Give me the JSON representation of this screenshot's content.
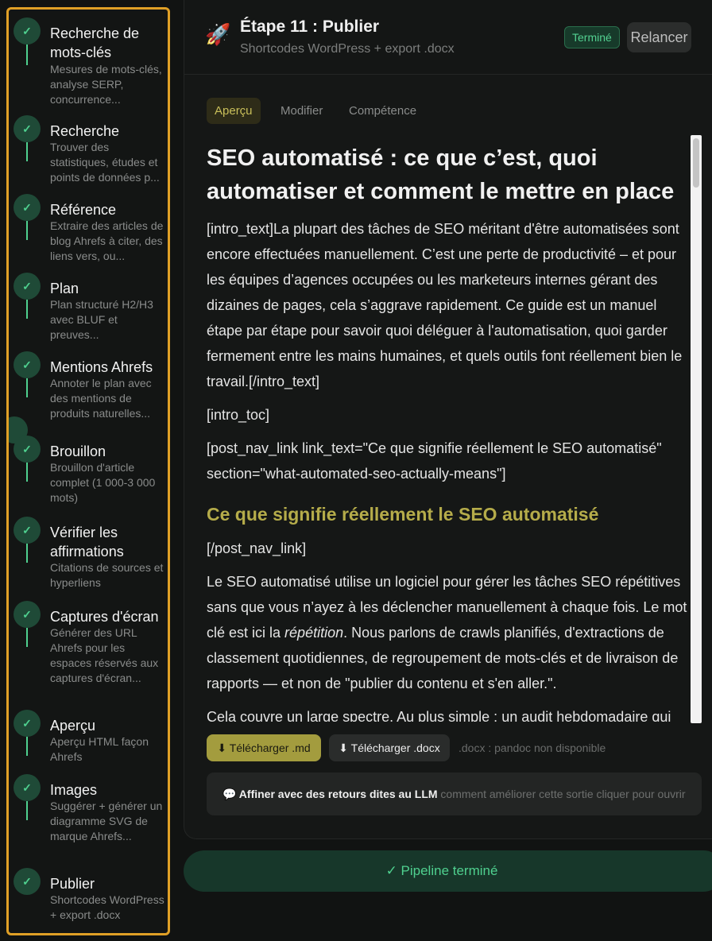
{
  "sidebar": {
    "steps": [
      {
        "title": "Recherche de mots-clés",
        "desc": "Mesures de mots-clés, analyse SERP, concurrence..."
      },
      {
        "title": "Recherche",
        "desc": "Trouver des statistiques, études et points de données p..."
      },
      {
        "title": "Référence",
        "desc": "Extraire des articles de blog Ahrefs à citer, des liens vers, ou..."
      },
      {
        "title": "Plan",
        "desc": "Plan structuré H2/H3 avec BLUF et preuves..."
      },
      {
        "title": "Mentions Ahrefs",
        "desc": "Annoter le plan avec des mentions de produits naturelles..."
      },
      {
        "title": "Brouillon",
        "desc": "Brouillon d'article complet (1 000-3 000 mots)"
      },
      {
        "title": "Vérifier les affirmations",
        "desc": "Citations de sources et hyperliens"
      },
      {
        "title": "Captures d'écran",
        "desc": "Générer des URL Ahrefs pour les espaces réservés aux captures d'écran..."
      },
      {
        "title": "Aperçu",
        "desc": "Aperçu HTML façon Ahrefs"
      },
      {
        "title": "Images",
        "desc": "Suggérer + générer un diagramme SVG de marque Ahrefs..."
      },
      {
        "title": "Publier",
        "desc": "Shortcodes WordPress + export .docx"
      }
    ],
    "check_glyph": "✓"
  },
  "header": {
    "icon": "🚀",
    "title": "Étape 11 : Publier",
    "subtitle": "Shortcodes WordPress + export .docx",
    "status_badge": "Terminé",
    "relaunch_label": "Relancer"
  },
  "tabs": [
    "Aperçu",
    "Modifier",
    "Compétence"
  ],
  "article": {
    "h1": "SEO automatisé : ce que c’est, quoi automatiser et comment le mettre en place",
    "intro": "[intro_text]La plupart des tâches de SEO méritant d'être automatisées sont encore effectuées manuellement. C’est une perte de productivité – et pour les équipes d’agences occupées ou les marketeurs internes gérant des dizaines de pages, cela s’aggrave rapidement. Ce guide est un manuel étape par étape pour savoir quoi déléguer à l'automatisation, quoi garder fermement entre les mains humaines, et quels outils font réellement bien le travail.[/intro_text]",
    "toc": "[intro_toc]",
    "nav_link": "[post_nav_link link_text=\"Ce que signifie réellement le SEO automatisé\" section=\"what-automated-seo-actually-means\"]",
    "h2": "Ce que signifie réellement le SEO automatisé",
    "nav_close": "[/post_nav_link]",
    "p1_before": "Le SEO automatisé utilise un logiciel pour gérer les tâches SEO répétitives sans que vous n’ayez à les déclencher manuellement à chaque fois. Le mot clé est ici la ",
    "p1_em": "répétition",
    "p1_after": ". Nous parlons de crawls planifiés, d'extractions de classement quotidiennes, de regroupement de mots-clés et de livraison de rapports — et non de \"publier du contenu et s'en aller.\".",
    "p2": "Cela couvre un large spectre. Au plus simple : un audit hebdomadaire qui"
  },
  "actions": {
    "download_md": "⬇ Télécharger .md",
    "download_docx": "⬇ Télécharger .docx",
    "docx_note": ".docx : pandoc non disponible"
  },
  "refine": {
    "label": "💬 Affiner avec des retours dites au LLM",
    "hint": " comment améliorer cette sortie cliquer pour ouvrir"
  },
  "pipeline": {
    "label": "✓ Pipeline terminé"
  },
  "colors": {
    "accent": "#e0a026",
    "success": "#4fd08f",
    "olive": "#a39c3e"
  }
}
